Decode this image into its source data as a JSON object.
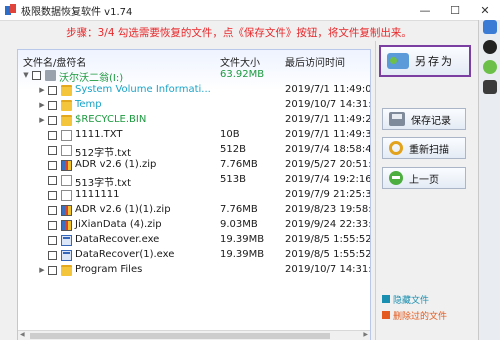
{
  "window": {
    "title": "极限数据恢复软件 v1.74",
    "minimize_glyph": "—",
    "maximize_glyph": "☐",
    "close_glyph": "✕"
  },
  "step_text": "步骤：3/4 勾选需要恢复的文件，点《保存文件》按钮，将文件复制出来。",
  "columns": {
    "name": "文件名/盘符名",
    "size": "文件大小",
    "time": "最后访问时间"
  },
  "rows": [
    {
      "name": "沃尔沃二翁(I:)",
      "size": "63.92MB",
      "time": "",
      "icon": "drive-icon",
      "color": "green",
      "level": 0,
      "expand": "▼"
    },
    {
      "name": "System Volume Informati...",
      "size": "",
      "time": "2019/7/1 11:49:0",
      "icon": "folder-icon",
      "color": "cyan",
      "level": 1,
      "expand": "▶"
    },
    {
      "name": "Temp",
      "size": "",
      "time": "2019/10/7 14:31:4",
      "icon": "folder-icon",
      "color": "cyan",
      "level": 1,
      "expand": "▶"
    },
    {
      "name": "$RECYCLE.BIN",
      "size": "",
      "time": "2019/7/1 11:49:20",
      "icon": "folder-icon",
      "color": "green",
      "level": 1,
      "expand": "▶"
    },
    {
      "name": "1111.TXT",
      "size": "10B",
      "time": "2019/7/1 11:49:32",
      "icon": "text-file-icon",
      "color": "dark",
      "level": 1,
      "expand": ""
    },
    {
      "name": "512字节.txt",
      "size": "512B",
      "time": "2019/7/4 18:58:4",
      "icon": "text-file-icon",
      "color": "dark",
      "level": 1,
      "expand": ""
    },
    {
      "name": "ADR v2.6 (1).zip",
      "size": "7.76MB",
      "time": "2019/5/27 20:51:4",
      "icon": "zip-file-icon",
      "color": "dark",
      "level": 1,
      "expand": ""
    },
    {
      "name": "513字节.txt",
      "size": "513B",
      "time": "2019/7/4 19:2:16",
      "icon": "text-file-icon",
      "color": "dark",
      "level": 1,
      "expand": ""
    },
    {
      "name": "1111111",
      "size": "",
      "time": "2019/7/9 21:25:32",
      "icon": "text-file-icon",
      "color": "dark",
      "level": 1,
      "expand": ""
    },
    {
      "name": "ADR v2.6 (1)(1).zip",
      "size": "7.76MB",
      "time": "2019/8/23 19:58:1",
      "icon": "zip-file-icon",
      "color": "dark",
      "level": 1,
      "expand": ""
    },
    {
      "name": "JiXianData (4).zip",
      "size": "9.03MB",
      "time": "2019/9/24 22:33:1",
      "icon": "zip-file-icon",
      "color": "dark",
      "level": 1,
      "expand": ""
    },
    {
      "name": "DataRecover.exe",
      "size": "19.39MB",
      "time": "2019/8/5 1:55:52",
      "icon": "exe-file-icon",
      "color": "dark",
      "level": 1,
      "expand": ""
    },
    {
      "name": "DataRecover(1).exe",
      "size": "19.39MB",
      "time": "2019/8/5 1:55:52",
      "icon": "exe-file-icon",
      "color": "dark",
      "level": 1,
      "expand": ""
    },
    {
      "name": "Program Files",
      "size": "",
      "time": "2019/10/7 14:31:1",
      "icon": "folder-icon",
      "color": "dark",
      "level": 1,
      "expand": "▶"
    }
  ],
  "buttons": {
    "save_file": "另存为",
    "save_record": "保存记录",
    "rescan": "重新扫描",
    "prev": "上一页"
  },
  "legend": {
    "hidden": "隐藏文件",
    "deleted": "删除过的文件"
  },
  "colors": {
    "step_text": "#e8272a",
    "green_item": "#1c9a3f",
    "cyan_item": "#1aa3c7",
    "hidden_legend": "#1a8fb0",
    "deleted_legend": "#e45a1e",
    "highlight_border": "#7a3fa1"
  }
}
